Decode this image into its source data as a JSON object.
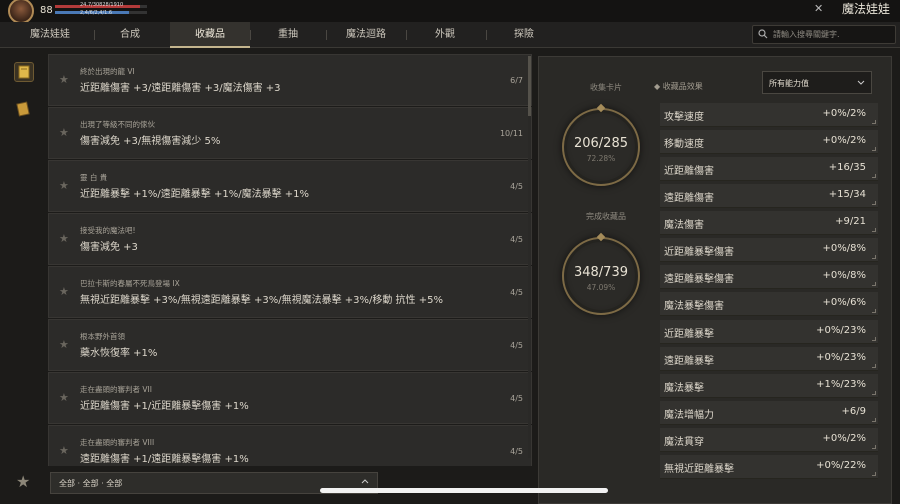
{
  "player": {
    "level": "88",
    "hp_text": "24.7/30828/1910",
    "mp_text": "2,4/6/2,4/1.6",
    "hp_fraction": 0.92,
    "mp_fraction": 0.8
  },
  "header": {
    "page_title": "魔法娃娃"
  },
  "tabs": [
    {
      "label": "魔法娃娃"
    },
    {
      "label": "合成"
    },
    {
      "label": "收藏品"
    },
    {
      "label": "重抽"
    },
    {
      "label": "魔法迴路"
    },
    {
      "label": "外觀"
    },
    {
      "label": "探險"
    }
  ],
  "search": {
    "placeholder": "請輸入搜尋關鍵字."
  },
  "collections": [
    {
      "name": "終於出現的龍 VI",
      "effect": "近距離傷害 +3/遠距離傷害 +3/魔法傷害 +3",
      "count": "6/7"
    },
    {
      "name": "出現了等級不同的傢伙",
      "effect": "傷害減免 +3/無視傷害減少 5%",
      "count": "10/11"
    },
    {
      "name": "靈 白 貴",
      "effect": "近距離暴擊 +1%/遠距離暴擊 +1%/魔法暴擊 +1%",
      "count": "4/5"
    },
    {
      "name": "接受我的魔法吧!",
      "effect": "傷害減免 +3",
      "count": "4/5"
    },
    {
      "name": "巴拉卡斯的春屬不死鳥登場 IX",
      "effect": "無視近距離暴擊 +3%/無視遠距離暴擊 +3%/無視魔法暴擊 +3%/移動 抗性 +5%",
      "count": "4/5"
    },
    {
      "name": "根本野外首領",
      "effect": "藥水恢復率 +1%",
      "count": "4/5"
    },
    {
      "name": "走在盡頭的審判者 VII",
      "effect": "近距離傷害 +1/近距離暴擊傷害 +1%",
      "count": "4/5"
    },
    {
      "name": "走在盡頭的審判者 VIII",
      "effect": "遠距離傷害 +1/遠距離暴擊傷害 +1%",
      "count": "4/5"
    }
  ],
  "filter": {
    "label": "全部 · 全部 · 全部"
  },
  "summary": {
    "cards": {
      "title": "收集卡片",
      "value": "206/285",
      "percent": "72.28%"
    },
    "items": {
      "title": "完成收藏品",
      "value": "348/739",
      "percent": "47.09%"
    }
  },
  "effects": {
    "header": "收藏品效果",
    "dropdown": "所有能力值",
    "stats": [
      {
        "label": "攻擊速度",
        "value": "+0%/2%"
      },
      {
        "label": "移動速度",
        "value": "+0%/2%"
      },
      {
        "label": "近距離傷害",
        "value": "+16/35"
      },
      {
        "label": "遠距離傷害",
        "value": "+15/34"
      },
      {
        "label": "魔法傷害",
        "value": "+9/21"
      },
      {
        "label": "近距離暴擊傷害",
        "value": "+0%/8%"
      },
      {
        "label": "遠距離暴擊傷害",
        "value": "+0%/8%"
      },
      {
        "label": "魔法暴擊傷害",
        "value": "+0%/6%"
      },
      {
        "label": "近距離暴擊",
        "value": "+0%/23%"
      },
      {
        "label": "遠距離暴擊",
        "value": "+0%/23%"
      },
      {
        "label": "魔法暴擊",
        "value": "+1%/23%"
      },
      {
        "label": "魔法增幅力",
        "value": "+6/9"
      },
      {
        "label": "魔法貫穿",
        "value": "+0%/2%"
      },
      {
        "label": "無視近距離暴擊",
        "value": "+0%/22%"
      }
    ]
  },
  "colors": {
    "accent": "#c4b58e",
    "background": "#1c1b19",
    "panel": "#2c2b29"
  }
}
